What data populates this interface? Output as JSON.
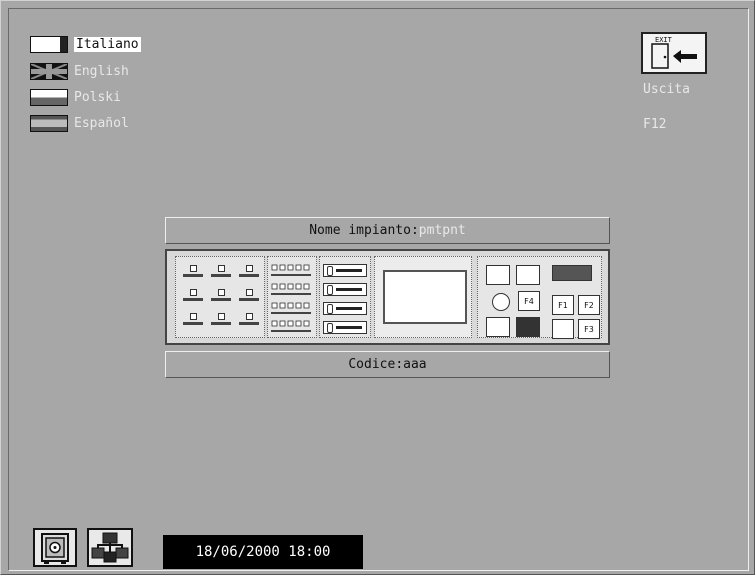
{
  "languages": [
    {
      "label": "Italiano",
      "active": true
    },
    {
      "label": "English",
      "active": false
    },
    {
      "label": "Polski",
      "active": false
    },
    {
      "label": "Español",
      "active": false
    }
  ],
  "exit": {
    "icon_text": "EXIT",
    "label": "Uscita",
    "shortcut": "F12"
  },
  "plant": {
    "name_label": "Nome impianto:",
    "name_value": "pmtpnt",
    "code_label": "Codice:",
    "code_value": "aaa"
  },
  "panel": {
    "menu_keys": [
      "",
      "",
      "",
      ""
    ],
    "function_keys": [
      "F1",
      "F2",
      "F3",
      "F4"
    ]
  },
  "status": {
    "datetime": "18/06/2000 18:00"
  },
  "icons": {
    "exit": "exit-door-icon",
    "safe": "safe-icon",
    "network": "network-icon"
  }
}
